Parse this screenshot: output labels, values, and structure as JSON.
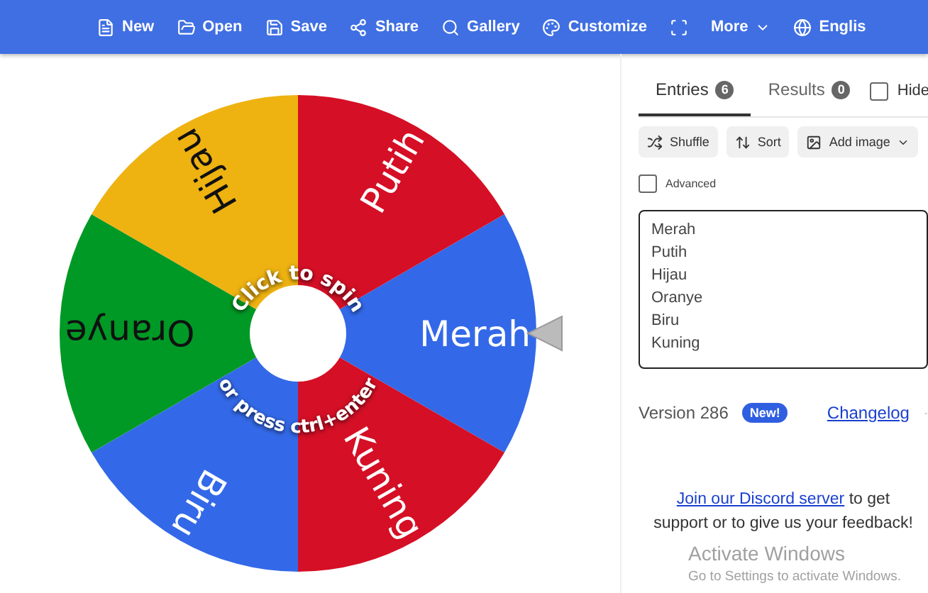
{
  "menu": [
    {
      "kind": "text",
      "label": "New"
    },
    {
      "kind": "text",
      "label": "Open"
    },
    {
      "kind": "text",
      "label": "Save"
    },
    {
      "kind": "text",
      "label": "Share"
    },
    {
      "kind": "text",
      "label": "Gallery"
    },
    {
      "kind": "text",
      "label": "Customize"
    },
    {
      "kind": "icon"
    },
    {
      "kind": "dropdown",
      "label": "More"
    },
    {
      "kind": "text",
      "label": "Englis"
    }
  ],
  "wheel": {
    "segments": [
      {
        "label": "Merah",
        "color": "#3369e8",
        "dark_text": false
      },
      {
        "label": "Kuning",
        "color": "#d50f25",
        "dark_text": false
      },
      {
        "label": "Biru",
        "color": "#3369e8",
        "dark_text": false
      },
      {
        "label": "Oranye",
        "color": "#009925",
        "dark_text": true
      },
      {
        "label": "Hijau",
        "color": "#eeb211",
        "dark_text": true
      },
      {
        "label": "Putih",
        "color": "#d50f25",
        "dark_text": false
      }
    ],
    "top_hint": "Click to spin",
    "bottom_hint": "or press ctrl+enter"
  },
  "tabs": [
    {
      "label": "Entries",
      "count": "6",
      "selected": true
    },
    {
      "label": "Results",
      "count": "0",
      "selected": false
    }
  ],
  "hide": {
    "label": "Hide",
    "checked": false
  },
  "tools": [
    "Shuffle",
    "Sort",
    "Add image"
  ],
  "advanced": {
    "label": "Advanced",
    "checked": false
  },
  "entries": [
    "Merah",
    "Putih",
    "Hijau",
    "Oranye",
    "Biru",
    "Kuning"
  ],
  "version": {
    "text": "Version 286",
    "badge": "New!",
    "link": "Changelog"
  },
  "discord": {
    "link": "Join our Discord server",
    "text": " to get support or to give us your feedback!"
  },
  "os_notice": {
    "title": "Activate Windows",
    "text": "Go to Settings to activate Windows."
  }
}
